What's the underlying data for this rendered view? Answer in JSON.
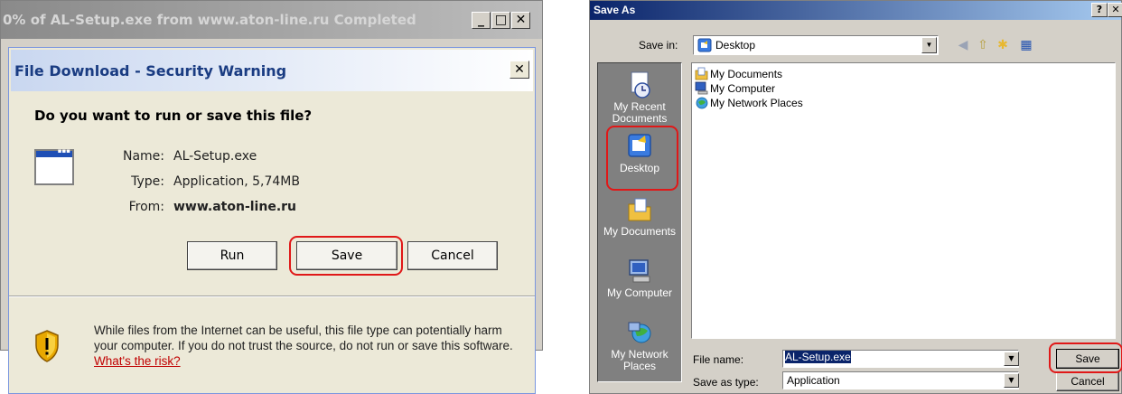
{
  "download_window": {
    "title": "0% of AL-Setup.exe from www.aton-line.ru Completed",
    "minimize_glyph": "_",
    "maximize_glyph": "□",
    "close_glyph": "✕"
  },
  "security_dialog": {
    "title": "File Download - Security Warning",
    "close_glyph": "✕",
    "question": "Do you want to run or save this file?",
    "icon": "application-window-icon",
    "fields": {
      "name_label": "Name:",
      "name_value": "AL-Setup.exe",
      "type_label": "Type:",
      "type_value": "Application, 5,74MB",
      "from_label": "From:",
      "from_value": "www.aton-line.ru"
    },
    "buttons": {
      "run": "Run",
      "save": "Save",
      "cancel": "Cancel"
    },
    "warning_icon": "shield-warning-icon",
    "warning_text": "While files from the Internet can be useful, this file type can potentially harm your computer. If you do not trust the source, do not run or save this software.",
    "risk_link": "What's the risk?",
    "highlight_color": "#e01818"
  },
  "save_as_dialog": {
    "title": "Save As",
    "help_glyph": "?",
    "close_glyph": "✕",
    "save_in_label": "Save in:",
    "save_in_value": "Desktop",
    "toolbar_icons": [
      "back-icon",
      "up-folder-icon",
      "new-folder-icon",
      "views-menu-icon"
    ],
    "places": [
      {
        "label": "My Recent Documents",
        "icon": "recent-documents-icon"
      },
      {
        "label": "Desktop",
        "icon": "desktop-icon"
      },
      {
        "label": "My Documents",
        "icon": "my-documents-icon"
      },
      {
        "label": "My Computer",
        "icon": "my-computer-icon"
      },
      {
        "label": "My Network Places",
        "icon": "network-places-icon"
      }
    ],
    "files": [
      {
        "label": "My Documents",
        "icon": "my-documents-icon"
      },
      {
        "label": "My Computer",
        "icon": "my-computer-icon"
      },
      {
        "label": "My Network Places",
        "icon": "network-places-icon"
      }
    ],
    "file_name_label": "File name:",
    "file_name_value": "AL-Setup.exe",
    "save_as_type_label": "Save as type:",
    "save_as_type_value": "Application",
    "dropdown_glyph": "▼",
    "buttons": {
      "save": "Save",
      "cancel": "Cancel"
    },
    "title_color": "#0a246a"
  }
}
